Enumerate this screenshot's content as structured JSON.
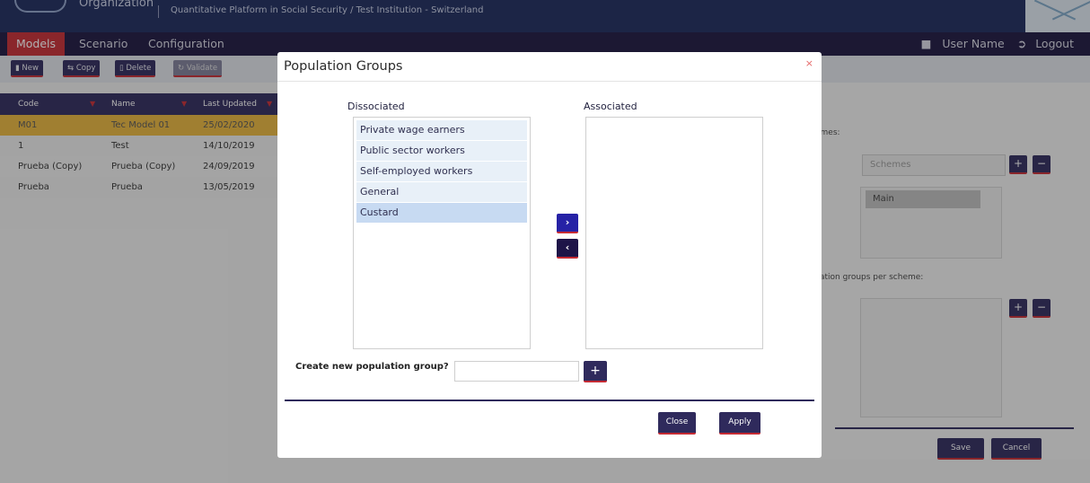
{
  "header": {
    "organization": "Organization",
    "subtitle": "Quantitative Platform in Social Security / Test Institution - Switzerland"
  },
  "menu": {
    "items": [
      "Models",
      "Scenario",
      "Configuration"
    ],
    "user_name": "User Name",
    "logout": "Logout"
  },
  "toolbar": {
    "new": "New",
    "copy": "Copy",
    "delete": "Delete",
    "validate": "Validate"
  },
  "table": {
    "headers": [
      "Code",
      "Name",
      "Last Updated"
    ],
    "rows": [
      [
        "M01",
        "Tec Model 01",
        "25/02/2020"
      ],
      [
        "1",
        "Test",
        "14/10/2019"
      ],
      [
        "Prueba (Copy)",
        "Prueba (Copy)",
        "24/09/2019"
      ],
      [
        "Prueba",
        "Prueba",
        "13/05/2019"
      ]
    ]
  },
  "right_panel": {
    "schemes_label": "emes:",
    "schemes_placeholder": "Schemes",
    "scheme_item": "Main",
    "groups_label": "ılation groups per scheme:",
    "save": "Save",
    "cancel": "Cancel"
  },
  "modal": {
    "title": "Population Groups",
    "close_icon": "×",
    "dissociated_label": "Dissociated",
    "associated_label": "Associated",
    "dissociated_items": [
      "Private wage earners",
      "Public sector workers",
      "Self-employed workers",
      "General",
      "Custard"
    ],
    "selected_item": "Custard",
    "move_right": "›",
    "move_left": "‹",
    "create_label": "Create new population group?",
    "add_button": "+",
    "close_button": "Close",
    "apply_button": "Apply"
  },
  "colors": {
    "navy": "#1d2a5c",
    "menu_bg": "#1c1640",
    "active_red": "#c52b34",
    "button_dark": "#2f2a5c",
    "arrow_blue": "#2622a6",
    "selected_row": "#e7b43d"
  }
}
